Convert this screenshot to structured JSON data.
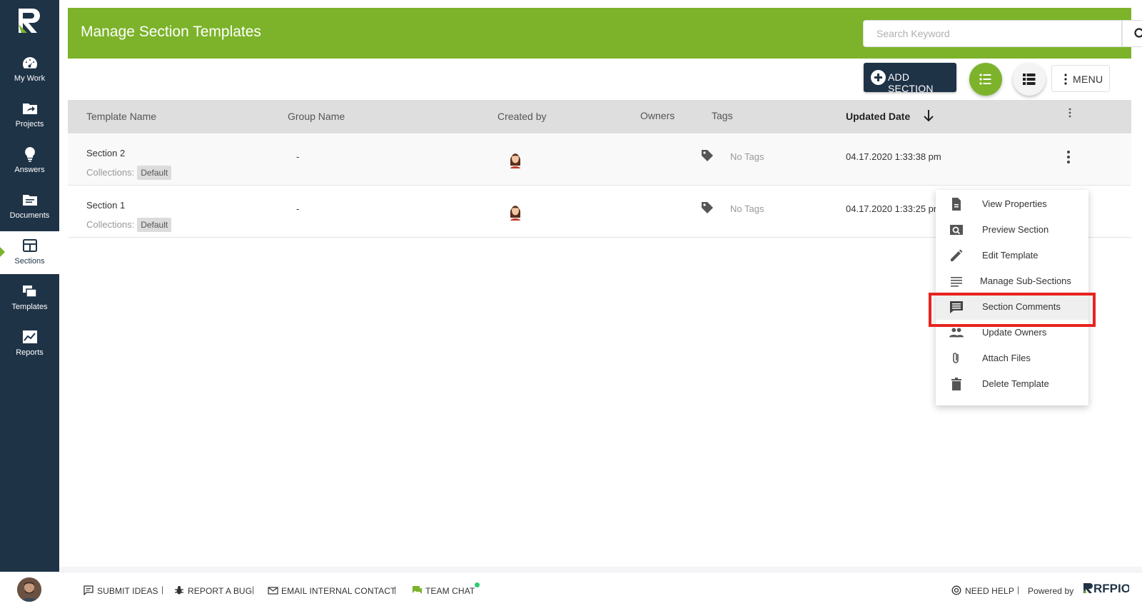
{
  "app": {
    "header_title": "Manage Section Templates",
    "search_placeholder": "Search Keyword",
    "brand": "RFPIO",
    "brand_color": "#7cb32a",
    "nav_color": "#1f3347"
  },
  "sidebar": {
    "items": [
      {
        "label": "My Work",
        "icon": "speedometer-icon"
      },
      {
        "label": "Projects",
        "icon": "folder-share-icon"
      },
      {
        "label": "Answers",
        "icon": "lightbulb-icon"
      },
      {
        "label": "Documents",
        "icon": "folder-doc-icon"
      },
      {
        "label": "Sections",
        "icon": "section-card-icon",
        "active": true
      },
      {
        "label": "Templates",
        "icon": "templates-stack-icon"
      },
      {
        "label": "Reports",
        "icon": "chart-icon"
      }
    ]
  },
  "toolbar": {
    "add_section_label": "ADD SECTION",
    "menu_label": "MENU"
  },
  "table": {
    "columns": {
      "template_name": "Template Name",
      "group_name": "Group Name",
      "created_by": "Created by",
      "owners": "Owners",
      "tags": "Tags",
      "updated_date": "Updated Date"
    },
    "rows": [
      {
        "name": "Section 2",
        "collections_label": "Collections:",
        "collection": "Default",
        "group": "-",
        "tags": "No Tags",
        "updated": "04.17.2020 1:33:38 pm"
      },
      {
        "name": "Section 1",
        "collections_label": "Collections:",
        "collection": "Default",
        "group": "-",
        "tags": "No Tags",
        "updated": "04.17.2020 1:33:25 pm"
      }
    ]
  },
  "context_menu": {
    "items": [
      {
        "label": "View Properties",
        "icon": "document-icon"
      },
      {
        "label": "Preview Section",
        "icon": "preview-icon"
      },
      {
        "label": "Edit Template",
        "icon": "pencil-icon"
      },
      {
        "label": "Manage Sub-Sections",
        "icon": "lines-icon"
      },
      {
        "label": "Section Comments",
        "icon": "comment-icon"
      },
      {
        "label": "Update Owners",
        "icon": "people-icon"
      },
      {
        "label": "Attach Files",
        "icon": "paperclip-icon"
      },
      {
        "label": "Delete Template",
        "icon": "trash-icon"
      }
    ]
  },
  "footer": {
    "submit_ideas": "SUBMIT IDEAS",
    "report_bug": "REPORT A BUG",
    "email_contact": "EMAIL INTERNAL CONTACT",
    "team_chat": "TEAM CHAT",
    "need_help": "NEED HELP",
    "powered_by": "Powered by"
  }
}
